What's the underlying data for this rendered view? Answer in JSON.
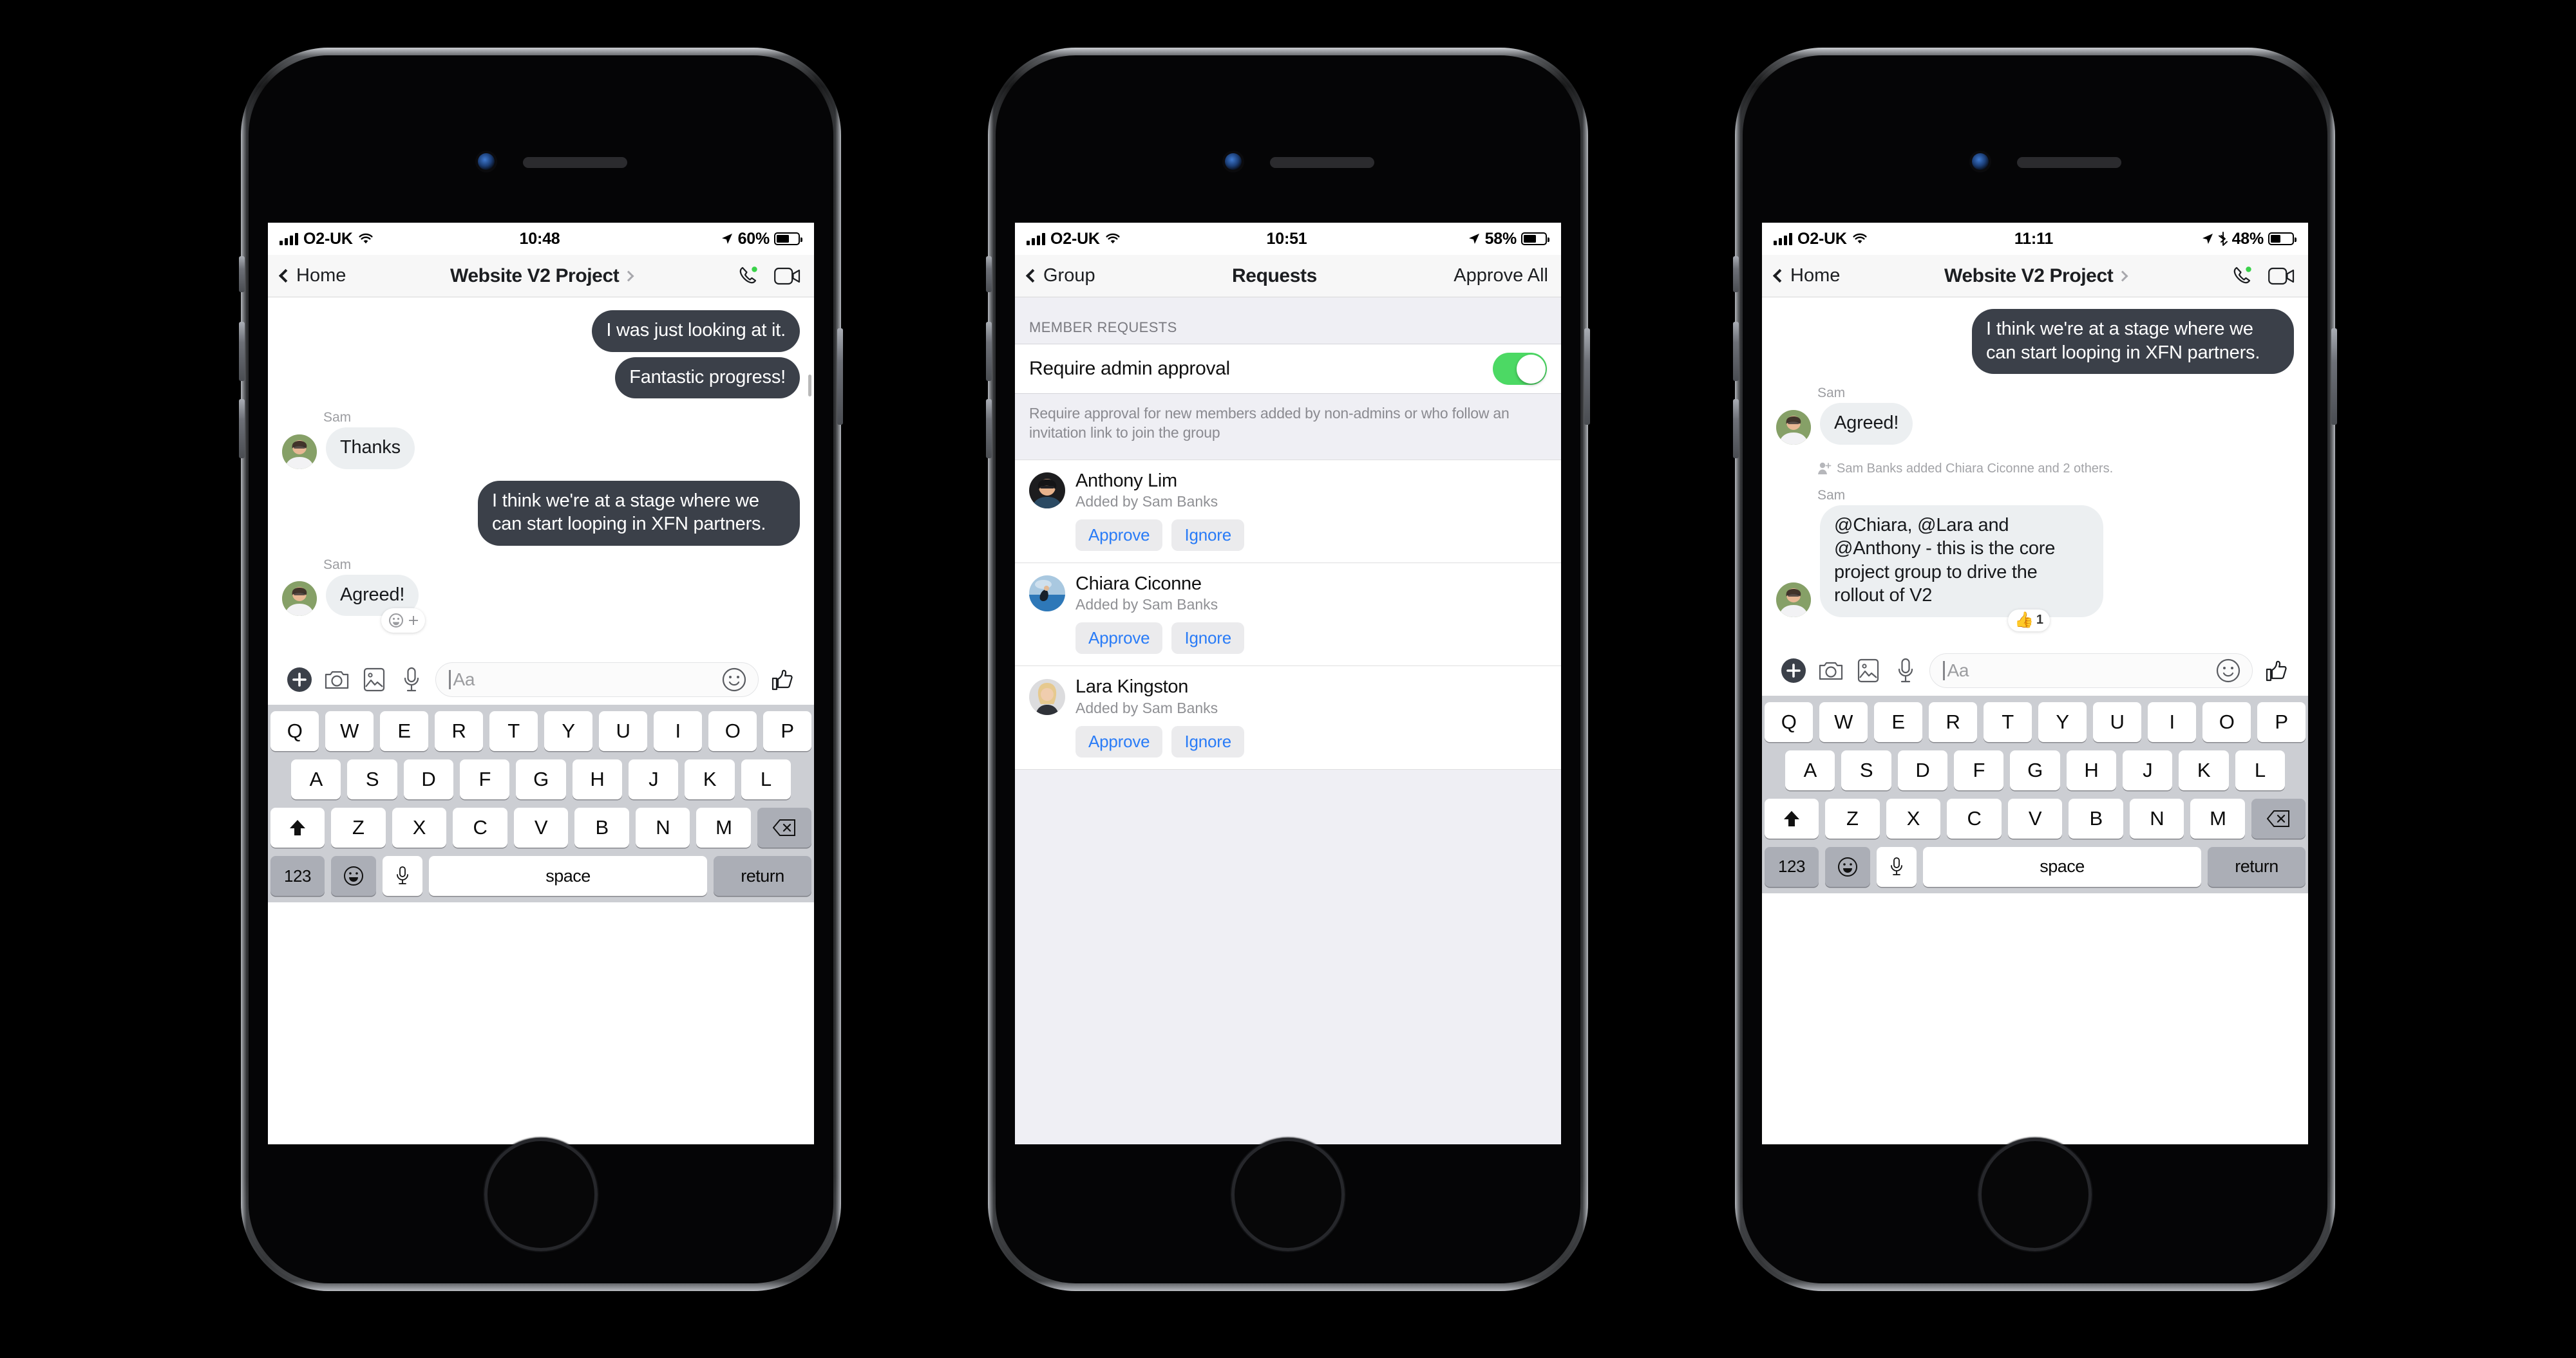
{
  "phones": [
    {
      "id": "phone-chat-before",
      "status": {
        "carrier": "O2-UK",
        "time": "10:48",
        "battery_pct": "60%",
        "wifi_icon": "wifi-icon",
        "signal_icon": "cellular-signal-icon",
        "location_icon": "location-arrow-icon",
        "battery_icon": "battery-icon",
        "bluetooth": false,
        "battery_fill": 60
      },
      "nav": {
        "back_label": "Home",
        "title": "Website V2 Project",
        "disclosure_icon": "chevron-right-icon",
        "audio_call_icon": "phone-call-icon",
        "video_call_icon": "video-camera-icon"
      },
      "messages": [
        {
          "dir": "out",
          "text": "I was just looking at it."
        },
        {
          "dir": "out",
          "text": "Fantastic progress!"
        },
        {
          "dir": "in",
          "sender": "Sam",
          "text": "Thanks",
          "avatar": "sam-avatar"
        },
        {
          "dir": "out",
          "text": "I think we're at a stage where we can start looping in XFN partners."
        },
        {
          "dir": "in",
          "sender": "Sam",
          "text": "Agreed!",
          "avatar": "sam-avatar",
          "reaction_picker_icon": "add-reaction-icon"
        }
      ],
      "composer": {
        "add_icon": "plus-circle-icon",
        "camera_icon": "camera-icon",
        "gallery_icon": "photo-gallery-icon",
        "mic_icon": "microphone-icon",
        "placeholder": "Aa",
        "sticker_icon": "emoji-smiley-icon",
        "like_icon": "thumbs-up-icon"
      },
      "keyboard": {
        "row1": [
          "Q",
          "W",
          "E",
          "R",
          "T",
          "Y",
          "U",
          "I",
          "O",
          "P"
        ],
        "row2": [
          "A",
          "S",
          "D",
          "F",
          "G",
          "H",
          "J",
          "K",
          "L"
        ],
        "row3": [
          "Z",
          "X",
          "C",
          "V",
          "B",
          "N",
          "M"
        ],
        "shift_icon": "shift-arrow-icon",
        "backspace_icon": "backspace-delete-icon",
        "numeric_label": "123",
        "emoji_icon": "emoji-smiley-icon",
        "dictation_icon": "microphone-icon",
        "space_label": "space",
        "return_label": "return"
      }
    },
    {
      "id": "phone-requests",
      "status": {
        "carrier": "O2-UK",
        "time": "10:51",
        "battery_pct": "58%",
        "wifi_icon": "wifi-icon",
        "signal_icon": "cellular-signal-icon",
        "location_icon": "location-arrow-icon",
        "battery_icon": "battery-icon",
        "bluetooth": false,
        "battery_fill": 58
      },
      "nav": {
        "back_label": "Group",
        "title": "Requests",
        "action_label": "Approve All"
      },
      "section_header": "MEMBER REQUESTS",
      "setting": {
        "label": "Require admin approval",
        "enabled": true,
        "toggle_on_color": "#4cd964",
        "footnote": "Require approval for new members added by non-admins or who follow an invitation link to join the group"
      },
      "requests": [
        {
          "name": "Anthony Lim",
          "subtitle": "Added by Sam Banks",
          "avatar": "anthony-avatar",
          "approve_label": "Approve",
          "ignore_label": "Ignore"
        },
        {
          "name": "Chiara Ciconne",
          "subtitle": "Added by Sam Banks",
          "avatar": "chiara-avatar",
          "approve_label": "Approve",
          "ignore_label": "Ignore"
        },
        {
          "name": "Lara Kingston",
          "subtitle": "Added by Sam Banks",
          "avatar": "lara-avatar",
          "approve_label": "Approve",
          "ignore_label": "Ignore"
        }
      ]
    },
    {
      "id": "phone-chat-after",
      "status": {
        "carrier": "O2-UK",
        "time": "11:11",
        "battery_pct": "48%",
        "wifi_icon": "wifi-icon",
        "signal_icon": "cellular-signal-icon",
        "location_icon": "location-arrow-icon",
        "bluetooth_icon": "bluetooth-icon",
        "battery_icon": "battery-icon",
        "bluetooth": true,
        "battery_fill": 48
      },
      "nav": {
        "back_label": "Home",
        "title": "Website V2 Project",
        "disclosure_icon": "chevron-right-icon",
        "audio_call_icon": "phone-call-icon",
        "video_call_icon": "video-camera-icon"
      },
      "messages": [
        {
          "dir": "out",
          "text": "I think we're at a stage where we can start looping in XFN partners."
        },
        {
          "dir": "in",
          "sender": "Sam",
          "text": "Agreed!",
          "avatar": "sam-avatar"
        },
        {
          "dir": "system",
          "icon": "add-person-icon",
          "text": "Sam Banks added Chiara Ciconne and 2 others."
        },
        {
          "dir": "in",
          "sender": "Sam",
          "text": "@Chiara, @Lara and @Anthony - this is the core project group to drive the rollout of V2",
          "avatar": "sam-avatar",
          "reaction": {
            "emoji": "👍",
            "count": "1"
          }
        }
      ],
      "composer": {
        "add_icon": "plus-circle-icon",
        "camera_icon": "camera-icon",
        "gallery_icon": "photo-gallery-icon",
        "mic_icon": "microphone-icon",
        "placeholder": "Aa",
        "sticker_icon": "emoji-smiley-icon",
        "like_icon": "thumbs-up-icon"
      },
      "keyboard": {
        "row1": [
          "Q",
          "W",
          "E",
          "R",
          "T",
          "Y",
          "U",
          "I",
          "O",
          "P"
        ],
        "row2": [
          "A",
          "S",
          "D",
          "F",
          "G",
          "H",
          "J",
          "K",
          "L"
        ],
        "row3": [
          "Z",
          "X",
          "C",
          "V",
          "B",
          "N",
          "M"
        ],
        "shift_icon": "shift-arrow-icon",
        "backspace_icon": "backspace-delete-icon",
        "numeric_label": "123",
        "emoji_icon": "emoji-smiley-icon",
        "dictation_icon": "microphone-icon",
        "space_label": "space",
        "return_label": "return"
      }
    }
  ],
  "colors": {
    "outgoing_bubble": "#3b4049",
    "incoming_bubble": "#eceff1",
    "accent_blue": "#2a7cf7",
    "toggle_green": "#4cd964",
    "page_background": "#000000"
  }
}
